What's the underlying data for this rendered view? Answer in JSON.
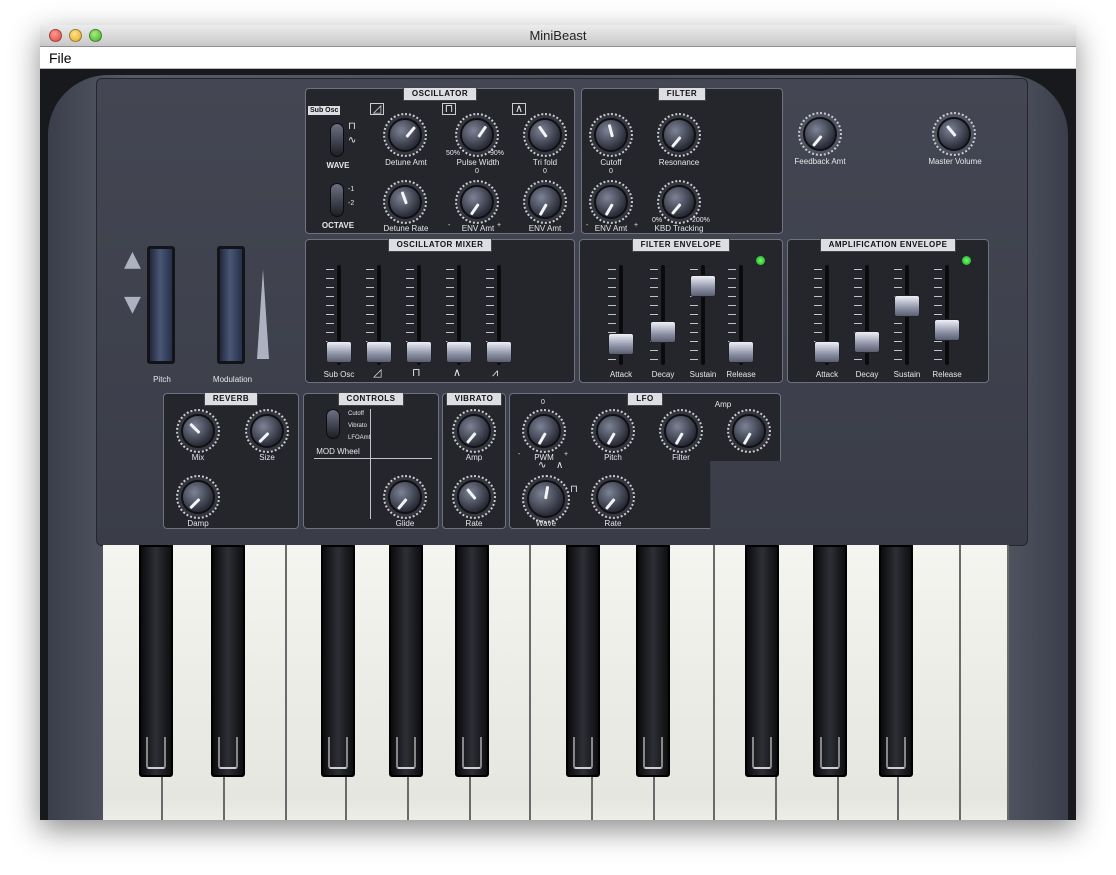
{
  "window": {
    "title": "MiniBeast"
  },
  "menu": {
    "file": "File"
  },
  "wheels": {
    "pitch": "Pitch",
    "modulation": "Modulation"
  },
  "oscillator": {
    "title": "OSCILLATOR",
    "sub_osc": "Sub Osc",
    "wave": "WAVE",
    "octave": "OCTAVE",
    "octave_m1": "-1",
    "octave_m2": "-2",
    "detune_amt": "Detune Amt",
    "detune_rate": "Detune Rate",
    "pulse_width": "Pulse Width",
    "pw_min": "50%",
    "pw_max": "90%",
    "env_amt": "ENV Amt",
    "tri_fold": "Tri fold",
    "env_amt_2": "ENV Amt",
    "zero_1": "0",
    "zero_2": "0",
    "minus": "-",
    "plus": "+"
  },
  "filter": {
    "title": "FILTER",
    "cutoff": "Cutoff",
    "resonance": "Resonance",
    "env_amt": "ENV Amt",
    "kbd_tracking": "KBD Tracking",
    "kbd_min": "0%",
    "kbd_max": "200%",
    "zero": "0",
    "minus": "-",
    "plus": "+"
  },
  "feedback": {
    "label": "Feedback Amt"
  },
  "master": {
    "label": "Master Volume"
  },
  "osc_mixer": {
    "title": "OSCILLATOR MIXER",
    "sub_osc": "Sub Osc"
  },
  "filter_env": {
    "title": "FILTER ENVELOPE",
    "attack": "Attack",
    "decay": "Decay",
    "sustain": "Sustain",
    "release": "Release",
    "levels": [
      0.15,
      0.3,
      0.88,
      0.05
    ]
  },
  "amp_env": {
    "title": "AMPLIFICATION ENVELOPE",
    "attack": "Attack",
    "decay": "Decay",
    "sustain": "Sustain",
    "release": "Release",
    "levels": [
      0.05,
      0.18,
      0.62,
      0.32
    ]
  },
  "mixer_levels": [
    0.05,
    0.05,
    0.05,
    0.05,
    0.05
  ],
  "reverb": {
    "title": "REVERB",
    "mix": "Mix",
    "size": "Size",
    "damp": "Damp"
  },
  "controls": {
    "title": "CONTROLS",
    "mod_wheel": "MOD Wheel",
    "cutoff": "Cutoff",
    "vibrato": "Vibrato",
    "lfo_amt": "LFOAmt",
    "glide": "Glide"
  },
  "vibrato": {
    "title": "VIBRATO",
    "amp": "Amp",
    "rate": "Rate"
  },
  "lfo": {
    "title": "LFO",
    "pwm": "PWM",
    "pitch": "Pitch",
    "filter": "Filter",
    "amp": "Amp",
    "wave": "Wave",
    "rate": "Rate",
    "zero": "0",
    "minus": "-",
    "plus": "+"
  },
  "icons": {
    "saw": "saw-wave-icon",
    "square": "square-wave-icon",
    "triangle": "triangle-wave-icon",
    "noise": "noise-wave-icon"
  }
}
